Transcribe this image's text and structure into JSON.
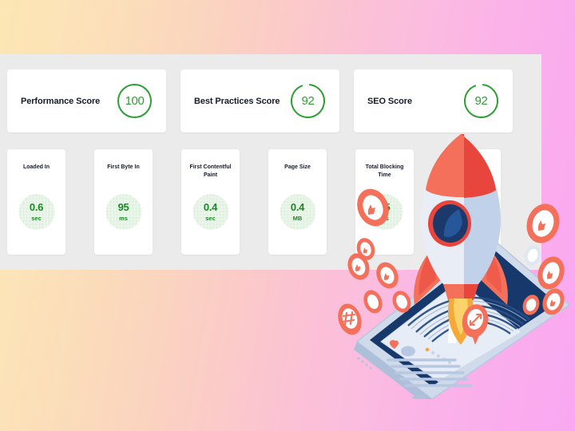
{
  "theme": {
    "panel_bg": "#ebebeb",
    "card_bg": "#ffffff",
    "accent_green": "#2e9e35",
    "value_green": "#1a8a22",
    "bubble_green": "#eaf5ea",
    "text_dark": "#171c2b",
    "bg_gradient_from": "#FCE6B4",
    "bg_gradient_to": "#F9A8F1",
    "rocket_orange": "#f4705a",
    "rocket_red": "#e8453c",
    "device_navy": "#1b3a6b",
    "device_light": "#dde4ee"
  },
  "scores": [
    {
      "label": "Performance Score",
      "value": "100",
      "percent": 100
    },
    {
      "label": "Best Practices Score",
      "value": "92",
      "percent": 92
    },
    {
      "label": "SEO Score",
      "value": "92",
      "percent": 92
    }
  ],
  "metrics": [
    {
      "label": "Loaded In",
      "value": "0.6",
      "unit": "sec"
    },
    {
      "label": "First Byte In",
      "value": "95",
      "unit": "ms"
    },
    {
      "label": "First Contentful Paint",
      "value": "0.4",
      "unit": "sec"
    },
    {
      "label": "Page Size",
      "value": "0.4",
      "unit": "MB"
    },
    {
      "label": "Total Blocking Time",
      "value": "25",
      "unit": "ms"
    },
    {
      "label": "",
      "value": "",
      "unit": ""
    }
  ],
  "illustration": {
    "name": "rocket-launching-from-tablet",
    "icons": [
      "thumbs-up-icon",
      "heart-icon",
      "hashtag-icon",
      "share-icon"
    ]
  }
}
